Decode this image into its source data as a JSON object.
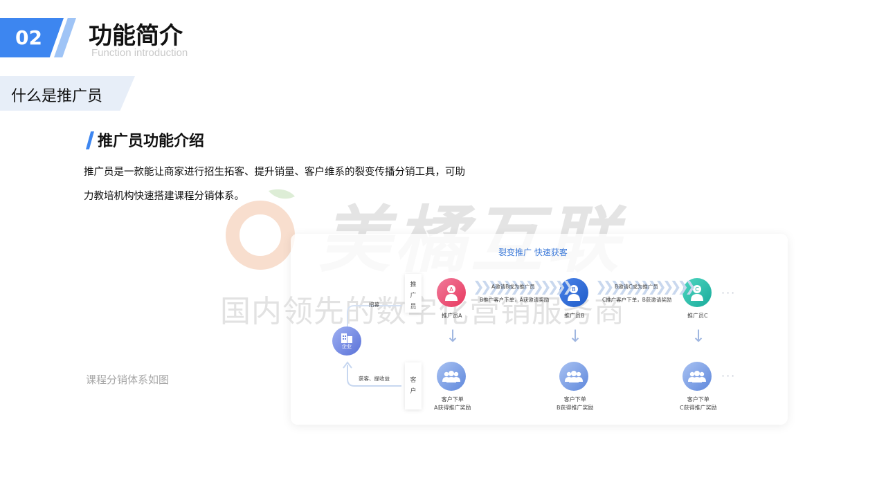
{
  "header": {
    "number": "02",
    "title": "功能简介",
    "subtitle": "Function introduction"
  },
  "section": {
    "tab_label": "什么是推广员"
  },
  "content": {
    "heading": "推广员功能介绍",
    "line1": "推广员是一款能让商家进行招生拓客、提升销量、客户维系的裂变传播分销工具，可助",
    "line2": "力教培机构快速搭建课程分销体系。",
    "caption": "课程分销体系如图"
  },
  "watermark": {
    "brand": "美橘互联",
    "slogan": "国内领先的数字化营销服务商"
  },
  "diagram": {
    "title": "裂变推广   快速获客",
    "promoter_label": "推广员",
    "customer_label": "客户",
    "recruit": "招募",
    "acquire": "获客、提收益",
    "enterprise": "企业",
    "nodes": [
      {
        "letter": "A",
        "name": "推广员A",
        "customer": "客户下单",
        "reward": "A获得推广奖励"
      },
      {
        "letter": "B",
        "name": "推广员B",
        "customer": "客户下单",
        "reward": "B获得推广奖励"
      },
      {
        "letter": "C",
        "name": "推广员C",
        "customer": "客户下单",
        "reward": "C获得推广奖励"
      }
    ],
    "links": [
      {
        "top": "A邀请B成为推广员",
        "bottom": "B推广客户下单，A获邀请奖励"
      },
      {
        "top": "B邀请C成为推广员",
        "bottom": "C推广客户下单，B获邀请奖励"
      }
    ],
    "ellipsis": "···"
  },
  "colors": {
    "accent": "#3d86f0",
    "accent_light": "#9fc4f6",
    "tab_bg": "#e7eef8",
    "node_a": "#e8385e",
    "node_b": "#1f5cc9",
    "node_c": "#19ab9b"
  }
}
